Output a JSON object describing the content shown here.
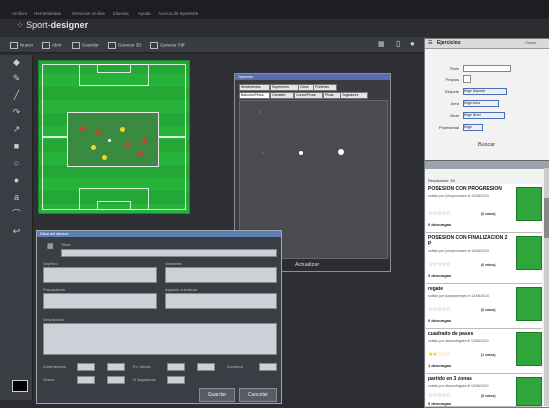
{
  "menu": [
    "Archivo",
    "Herramientas",
    "Servicios on-line",
    "Idiomas",
    "Ayuda",
    "Acerca de SportsDe"
  ],
  "logo": {
    "prefix": "Sport-",
    "bold": "designer"
  },
  "toolbar": [
    "Nuevo",
    "Abrir",
    "Guardar",
    "Generar 3D",
    "Generar Pdf"
  ],
  "ejercicios": {
    "title": "Ejercicios",
    "close": "Ocultar",
    "fields": {
      "titulo": "Titulo",
      "propios": "Propios",
      "deporte": "Deporte",
      "area": "Area",
      "nivel": "Nivel",
      "profesional": "Profesional"
    },
    "select_placeholder": "Elige Deporte",
    "select_area": "Elige Area",
    "select_nivel": "Elige Nivel",
    "select_prof": "Elige",
    "buscar": "Buscar",
    "resultados": "Resultados: 28",
    "cards": [
      {
        "title": "POSESION CON PROGRESION",
        "sub": "subido por johnpromares el 10/06/2010",
        "votes": "(0 votos)",
        "downloads": "0 descargas"
      },
      {
        "title": "POSESION CON FINALIZACION 2 P",
        "sub": "subido por johnpromares el 10/06/2010",
        "votes": "(0 votos)",
        "downloads": "0 descargas"
      },
      {
        "title": "regate",
        "sub": "subido por juanjosereyes el 13/06/2010",
        "votes": "(0 votos)",
        "downloads": "0 descargas"
      },
      {
        "title": "cuadrado de pases",
        "sub": "subido por diasrodriguez el 13/06/2010",
        "votes": "(1 votos)",
        "downloads": "1 descargas"
      },
      {
        "title": "partido en 3 zonas",
        "sub": "subido por diasrodriguez el 13/06/2010",
        "votes": "(0 votos)",
        "downloads": "0 descargas"
      }
    ]
  },
  "opciones": {
    "title": "Opciones",
    "tabs_row1": [
      "Movimientos",
      "Superiores",
      "Otros",
      "Porterias"
    ],
    "tabs_row2": [
      "Balones/Petos",
      "Caracter.",
      "Conos/Picas",
      "Picas",
      "Jugadores"
    ],
    "actualizar": "Actualizar"
  },
  "datos": {
    "title": "Datos del ejercicio",
    "titulo": "Titulo",
    "objetivo": "Objetivo",
    "variantes": "Variantes",
    "preparatorio": "Preparatorio",
    "aspecto": "Aspecto a evaluar",
    "descripcion": "Descripcion",
    "dimensiones": "Dimensiones",
    "fc_media": "Fc. Media",
    "duracion": "Duracion",
    "series": "Series",
    "n_jugadores": "N Jugadores",
    "guardar": "Guardar",
    "cancelar": "Cancelar"
  }
}
